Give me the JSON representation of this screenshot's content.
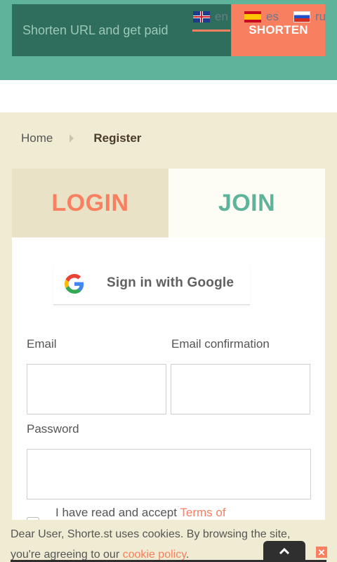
{
  "shorten": {
    "placeholder": "Shorten URL and get paid",
    "button_label": "SHORTEN"
  },
  "languages": [
    {
      "code": "en",
      "flag": "uk-flag-icon",
      "active": true
    },
    {
      "code": "es",
      "flag": "spain-flag-icon",
      "active": false
    },
    {
      "code": "ru",
      "flag": "russia-flag-icon",
      "active": false
    }
  ],
  "breadcrumb": {
    "home": "Home",
    "current": "Register"
  },
  "tabs": {
    "login": "LOGIN",
    "join": "JOIN"
  },
  "google": {
    "label": "Sign in with Google",
    "icon": "google-icon"
  },
  "form": {
    "email_label": "Email",
    "email_value": "",
    "email_confirm_label": "Email confirmation",
    "email_confirm_value": "",
    "password_label": "Password",
    "password_value": "",
    "accept_prefix": "I have read and accept ",
    "accept_link": "Terms of"
  },
  "cookie": {
    "text_prefix": "Dear User, Shorte.st uses cookies. By browsing the site, you're agreeing to our ",
    "link": "cookie policy",
    "text_suffix": ".",
    "scroll_top_icon": "chevron-up-icon",
    "close_icon": "close-icon"
  },
  "colors": {
    "teal": "#5fb39b",
    "dark_teal": "#2f6e5c",
    "coral": "#f87f5f",
    "background": "#f0ecd3"
  }
}
